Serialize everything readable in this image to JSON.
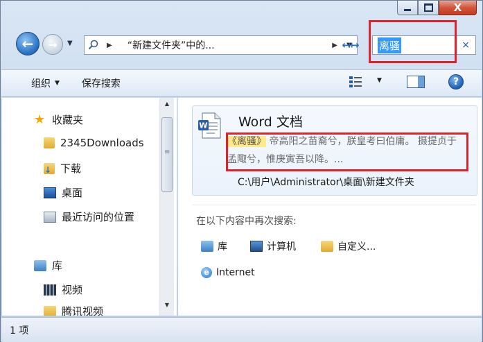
{
  "window": {
    "controls": {
      "minimize": "—",
      "maximize": "□",
      "close": "X"
    }
  },
  "nav": {
    "address_path": "“新建文件夹”中的...",
    "search_query": "离骚",
    "clear_glyph": "×"
  },
  "toolbar": {
    "organize": "组织",
    "save_search": "保存搜索"
  },
  "navpane": {
    "favorites": "收藏夹",
    "items": [
      "2345Downloads",
      "下载",
      "桌面",
      "最近访问的位置"
    ],
    "library": "库",
    "lib_items": [
      "视频",
      "腾讯视频"
    ]
  },
  "result": {
    "title": "Word 文档",
    "keyword": "《离骚》",
    "snippet_rest": " 帝高阳之苗裔兮，朕皇考曰伯庸。 摄提贞于孟陬兮，惟庚寅吾以降。...",
    "path": "C:\\用户\\Administrator\\桌面\\新建文件夹"
  },
  "search_again": {
    "label": "在以下内容中再次搜索:",
    "locations": [
      "库",
      "计算机",
      "自定义...",
      "Internet"
    ]
  },
  "status": {
    "count": "1 项"
  }
}
